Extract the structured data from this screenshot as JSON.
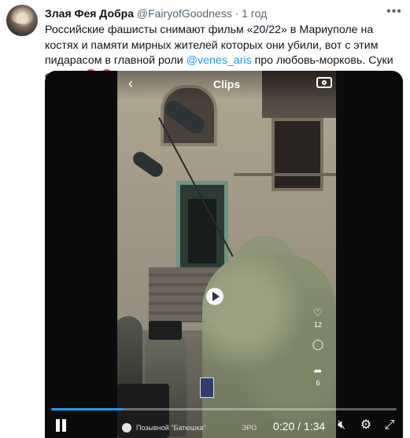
{
  "tweet": {
    "author_name": "Злая Фея Добра",
    "author_handle": "@FairyofGoodness",
    "separator": "·",
    "time": "1 год",
    "text_part1": "Российские фашисты снимают фильм «20/22» в Мариуполе на костях и памяти мирных жителей которых они убили, вот с этим пидарасом в главной роли ",
    "mention": "@venes_aris",
    "text_part2": " про любовь-морковь. Суки ебучие ",
    "more_icon": "ellipsis-icon"
  },
  "video": {
    "overlay_title": "Clips",
    "back_icon": "‹",
    "camera_icon": "camera-icon",
    "like_count": "12",
    "comment_count": "",
    "share_count": "6",
    "channel_name": "Позывной \"Батюшка\"",
    "channel_tag": "ЭРО"
  },
  "player": {
    "current_time": "0:20",
    "duration": "1:34",
    "time_display": "0:20 / 1:34",
    "progress": 0.21,
    "accent": "#1d9bf0",
    "icons": [
      "pause-icon",
      "volume-muted-icon",
      "settings-icon",
      "expand-icon"
    ]
  }
}
